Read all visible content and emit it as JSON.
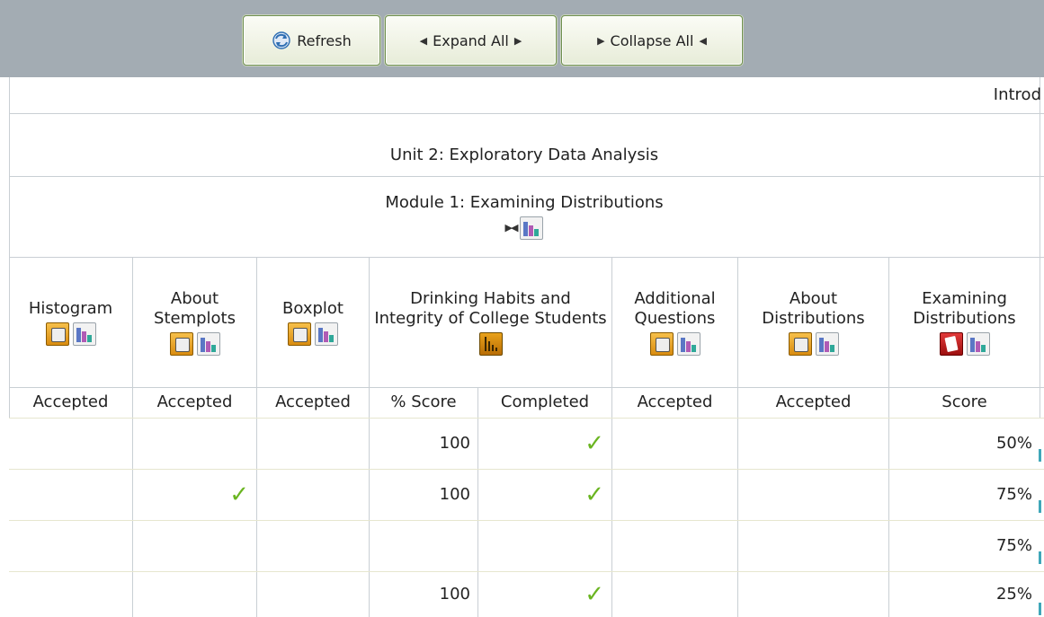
{
  "toolbar": {
    "refresh_label": "Refresh",
    "expand_label": "Expand All",
    "collapse_label": "Collapse All"
  },
  "header": {
    "section_label": "Introd",
    "unit_title": "Unit 2: Exploratory Data Analysis",
    "module_title": "Module 1: Examining Distributions"
  },
  "columns": [
    {
      "title": "Histogram",
      "icons": [
        "review-icon",
        "stats-icon"
      ],
      "status": "Accepted"
    },
    {
      "title": "About Stemplots",
      "icons": [
        "review-icon",
        "stats-icon"
      ],
      "status": "Accepted"
    },
    {
      "title": "Boxplot",
      "icons": [
        "review-icon",
        "stats-icon"
      ],
      "status": "Accepted"
    },
    {
      "title": "Drinking Habits and Integrity of College Students",
      "icons": [
        "bar-chart-icon"
      ],
      "statuses": [
        "% Score",
        "Completed"
      ]
    },
    {
      "title": "Additional Questions",
      "icons": [
        "review-icon",
        "stats-icon"
      ],
      "status": "Accepted"
    },
    {
      "title": "About Distributions",
      "icons": [
        "review-icon",
        "stats-icon"
      ],
      "status": "Accepted"
    },
    {
      "title": "Examining Distributions",
      "icons": [
        "pdf-icon",
        "stats-icon"
      ],
      "status": "Score"
    }
  ],
  "rows": [
    {
      "histogram": "",
      "stemplots": "",
      "boxplot": "",
      "pct_score": "100",
      "completed": "✓",
      "additional": "",
      "about": "",
      "score": "50%"
    },
    {
      "histogram": "",
      "stemplots": "✓",
      "boxplot": "",
      "pct_score": "100",
      "completed": "✓",
      "additional": "",
      "about": "",
      "score": "75%"
    },
    {
      "histogram": "",
      "stemplots": "",
      "boxplot": "",
      "pct_score": "",
      "completed": "",
      "additional": "",
      "about": "",
      "score": "75%"
    },
    {
      "histogram": "",
      "stemplots": "",
      "boxplot": "",
      "pct_score": "100",
      "completed": "✓",
      "additional": "",
      "about": "",
      "score": "25%"
    }
  ],
  "colors": {
    "toolbar_bg": "#a3acb3",
    "check_green": "#6ab521",
    "grid_line": "#c9cfd4"
  }
}
